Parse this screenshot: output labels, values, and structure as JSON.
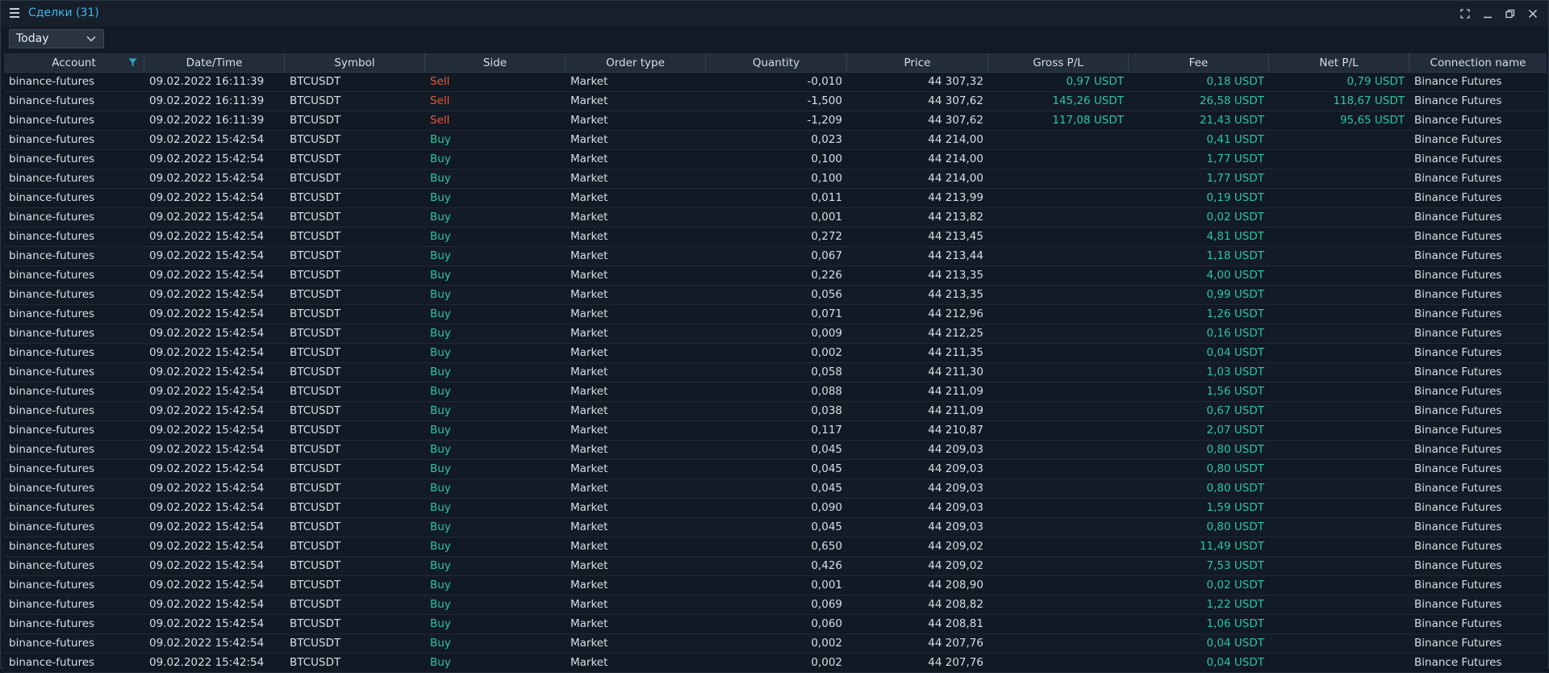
{
  "window": {
    "title": "Сделки (31)"
  },
  "filter": {
    "selected": "Today"
  },
  "colors": {
    "accent": "#45b6e8",
    "sell": "#e85a3a",
    "buy": "#2ec4a0"
  },
  "icons": {
    "menu": "hamburger-icon",
    "filter": "funnel-icon",
    "maximize": "fullscreen-icon",
    "minimize": "minimize-icon",
    "restore": "restore-icon",
    "close": "close-icon",
    "dropdown": "chevron-down-icon"
  },
  "table": {
    "columns": [
      "Account",
      "Date/Time",
      "Symbol",
      "Side",
      "Order type",
      "Quantity",
      "Price",
      "Gross P/L",
      "Fee",
      "Net P/L",
      "Connection name"
    ],
    "rows": [
      [
        "binance-futures",
        "09.02.2022 16:11:39",
        "BTCUSDT",
        "Sell",
        "Market",
        "-0,010",
        "44 307,32",
        "0,97 USDT",
        "0,18 USDT",
        "0,79 USDT",
        "Binance Futures"
      ],
      [
        "binance-futures",
        "09.02.2022 16:11:39",
        "BTCUSDT",
        "Sell",
        "Market",
        "-1,500",
        "44 307,62",
        "145,26 USDT",
        "26,58 USDT",
        "118,67 USDT",
        "Binance Futures"
      ],
      [
        "binance-futures",
        "09.02.2022 16:11:39",
        "BTCUSDT",
        "Sell",
        "Market",
        "-1,209",
        "44 307,62",
        "117,08 USDT",
        "21,43 USDT",
        "95,65 USDT",
        "Binance Futures"
      ],
      [
        "binance-futures",
        "09.02.2022 15:42:54",
        "BTCUSDT",
        "Buy",
        "Market",
        "0,023",
        "44 214,00",
        "",
        "0,41 USDT",
        "",
        "Binance Futures"
      ],
      [
        "binance-futures",
        "09.02.2022 15:42:54",
        "BTCUSDT",
        "Buy",
        "Market",
        "0,100",
        "44 214,00",
        "",
        "1,77 USDT",
        "",
        "Binance Futures"
      ],
      [
        "binance-futures",
        "09.02.2022 15:42:54",
        "BTCUSDT",
        "Buy",
        "Market",
        "0,100",
        "44 214,00",
        "",
        "1,77 USDT",
        "",
        "Binance Futures"
      ],
      [
        "binance-futures",
        "09.02.2022 15:42:54",
        "BTCUSDT",
        "Buy",
        "Market",
        "0,011",
        "44 213,99",
        "",
        "0,19 USDT",
        "",
        "Binance Futures"
      ],
      [
        "binance-futures",
        "09.02.2022 15:42:54",
        "BTCUSDT",
        "Buy",
        "Market",
        "0,001",
        "44 213,82",
        "",
        "0,02 USDT",
        "",
        "Binance Futures"
      ],
      [
        "binance-futures",
        "09.02.2022 15:42:54",
        "BTCUSDT",
        "Buy",
        "Market",
        "0,272",
        "44 213,45",
        "",
        "4,81 USDT",
        "",
        "Binance Futures"
      ],
      [
        "binance-futures",
        "09.02.2022 15:42:54",
        "BTCUSDT",
        "Buy",
        "Market",
        "0,067",
        "44 213,44",
        "",
        "1,18 USDT",
        "",
        "Binance Futures"
      ],
      [
        "binance-futures",
        "09.02.2022 15:42:54",
        "BTCUSDT",
        "Buy",
        "Market",
        "0,226",
        "44 213,35",
        "",
        "4,00 USDT",
        "",
        "Binance Futures"
      ],
      [
        "binance-futures",
        "09.02.2022 15:42:54",
        "BTCUSDT",
        "Buy",
        "Market",
        "0,056",
        "44 213,35",
        "",
        "0,99 USDT",
        "",
        "Binance Futures"
      ],
      [
        "binance-futures",
        "09.02.2022 15:42:54",
        "BTCUSDT",
        "Buy",
        "Market",
        "0,071",
        "44 212,96",
        "",
        "1,26 USDT",
        "",
        "Binance Futures"
      ],
      [
        "binance-futures",
        "09.02.2022 15:42:54",
        "BTCUSDT",
        "Buy",
        "Market",
        "0,009",
        "44 212,25",
        "",
        "0,16 USDT",
        "",
        "Binance Futures"
      ],
      [
        "binance-futures",
        "09.02.2022 15:42:54",
        "BTCUSDT",
        "Buy",
        "Market",
        "0,002",
        "44 211,35",
        "",
        "0,04 USDT",
        "",
        "Binance Futures"
      ],
      [
        "binance-futures",
        "09.02.2022 15:42:54",
        "BTCUSDT",
        "Buy",
        "Market",
        "0,058",
        "44 211,30",
        "",
        "1,03 USDT",
        "",
        "Binance Futures"
      ],
      [
        "binance-futures",
        "09.02.2022 15:42:54",
        "BTCUSDT",
        "Buy",
        "Market",
        "0,088",
        "44 211,09",
        "",
        "1,56 USDT",
        "",
        "Binance Futures"
      ],
      [
        "binance-futures",
        "09.02.2022 15:42:54",
        "BTCUSDT",
        "Buy",
        "Market",
        "0,038",
        "44 211,09",
        "",
        "0,67 USDT",
        "",
        "Binance Futures"
      ],
      [
        "binance-futures",
        "09.02.2022 15:42:54",
        "BTCUSDT",
        "Buy",
        "Market",
        "0,117",
        "44 210,87",
        "",
        "2,07 USDT",
        "",
        "Binance Futures"
      ],
      [
        "binance-futures",
        "09.02.2022 15:42:54",
        "BTCUSDT",
        "Buy",
        "Market",
        "0,045",
        "44 209,03",
        "",
        "0,80 USDT",
        "",
        "Binance Futures"
      ],
      [
        "binance-futures",
        "09.02.2022 15:42:54",
        "BTCUSDT",
        "Buy",
        "Market",
        "0,045",
        "44 209,03",
        "",
        "0,80 USDT",
        "",
        "Binance Futures"
      ],
      [
        "binance-futures",
        "09.02.2022 15:42:54",
        "BTCUSDT",
        "Buy",
        "Market",
        "0,045",
        "44 209,03",
        "",
        "0,80 USDT",
        "",
        "Binance Futures"
      ],
      [
        "binance-futures",
        "09.02.2022 15:42:54",
        "BTCUSDT",
        "Buy",
        "Market",
        "0,090",
        "44 209,03",
        "",
        "1,59 USDT",
        "",
        "Binance Futures"
      ],
      [
        "binance-futures",
        "09.02.2022 15:42:54",
        "BTCUSDT",
        "Buy",
        "Market",
        "0,045",
        "44 209,03",
        "",
        "0,80 USDT",
        "",
        "Binance Futures"
      ],
      [
        "binance-futures",
        "09.02.2022 15:42:54",
        "BTCUSDT",
        "Buy",
        "Market",
        "0,650",
        "44 209,02",
        "",
        "11,49 USDT",
        "",
        "Binance Futures"
      ],
      [
        "binance-futures",
        "09.02.2022 15:42:54",
        "BTCUSDT",
        "Buy",
        "Market",
        "0,426",
        "44 209,02",
        "",
        "7,53 USDT",
        "",
        "Binance Futures"
      ],
      [
        "binance-futures",
        "09.02.2022 15:42:54",
        "BTCUSDT",
        "Buy",
        "Market",
        "0,001",
        "44 208,90",
        "",
        "0,02 USDT",
        "",
        "Binance Futures"
      ],
      [
        "binance-futures",
        "09.02.2022 15:42:54",
        "BTCUSDT",
        "Buy",
        "Market",
        "0,069",
        "44 208,82",
        "",
        "1,22 USDT",
        "",
        "Binance Futures"
      ],
      [
        "binance-futures",
        "09.02.2022 15:42:54",
        "BTCUSDT",
        "Buy",
        "Market",
        "0,060",
        "44 208,81",
        "",
        "1,06 USDT",
        "",
        "Binance Futures"
      ],
      [
        "binance-futures",
        "09.02.2022 15:42:54",
        "BTCUSDT",
        "Buy",
        "Market",
        "0,002",
        "44 207,76",
        "",
        "0,04 USDT",
        "",
        "Binance Futures"
      ],
      [
        "binance-futures",
        "09.02.2022 15:42:54",
        "BTCUSDT",
        "Buy",
        "Market",
        "0,002",
        "44 207,76",
        "",
        "0,04 USDT",
        "",
        "Binance Futures"
      ]
    ]
  }
}
